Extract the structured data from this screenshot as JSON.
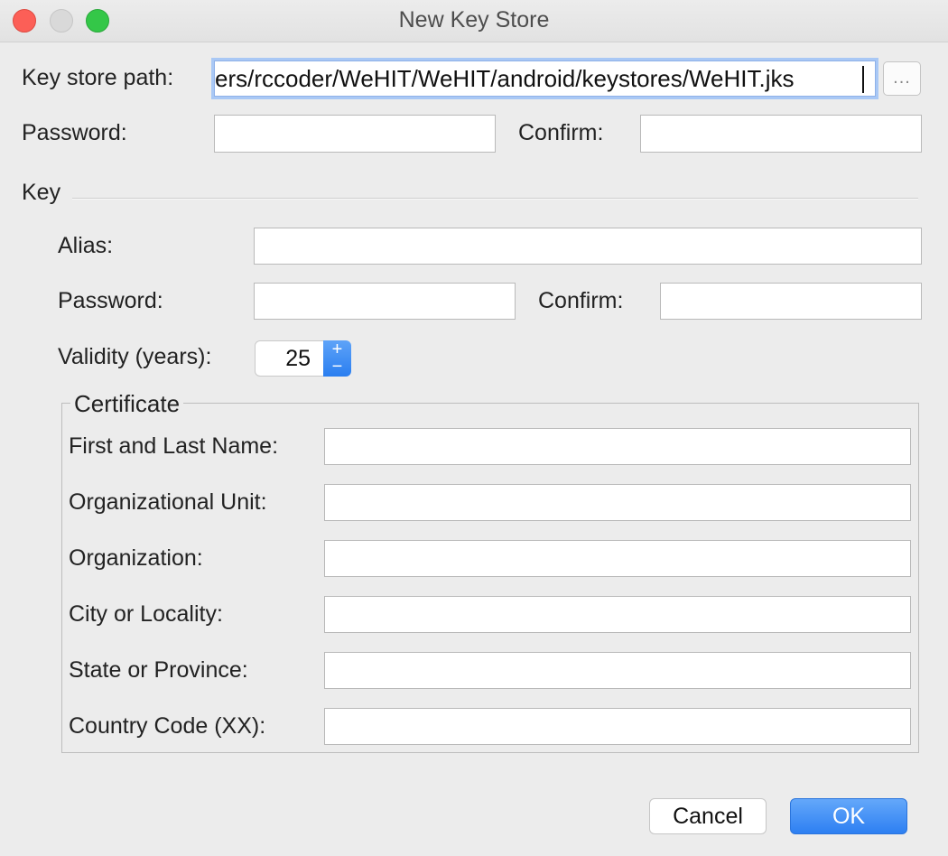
{
  "window": {
    "title": "New Key Store"
  },
  "keystore": {
    "path_label": "Key store path:",
    "path_value": "ers/rccoder/WeHIT/WeHIT/android/keystores/WeHIT.jks",
    "browse_label": "...",
    "password_label": "Password:",
    "confirm_label": "Confirm:"
  },
  "key": {
    "section_label": "Key",
    "alias_label": "Alias:",
    "password_label": "Password:",
    "confirm_label": "Confirm:",
    "validity_label": "Validity (years):",
    "validity_value": "25",
    "increment_symbol": "+",
    "decrement_symbol": "−"
  },
  "certificate": {
    "title": "Certificate",
    "first_last_name_label": "First and Last Name:",
    "org_unit_label": "Organizational Unit:",
    "organization_label": "Organization:",
    "city_label": "City or Locality:",
    "state_label": "State or Province:",
    "country_label": "Country Code (XX):"
  },
  "buttons": {
    "cancel": "Cancel",
    "ok": "OK"
  },
  "colors": {
    "accent": "#2d7ff2",
    "close": "#fc5f57",
    "zoom": "#34c748"
  }
}
